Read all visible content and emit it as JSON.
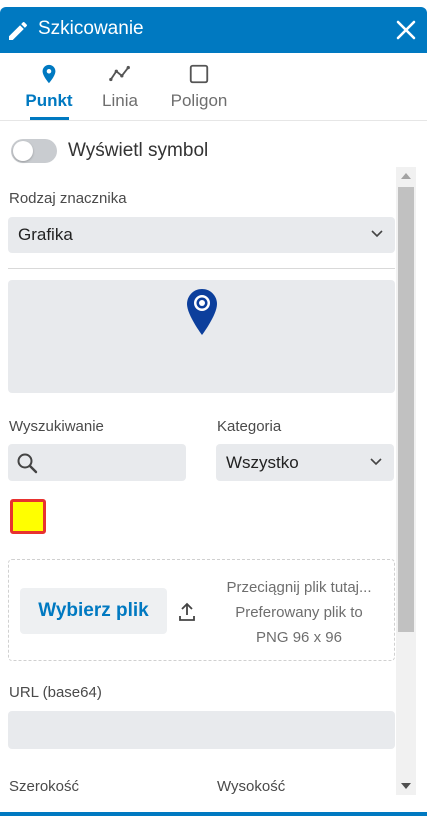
{
  "header": {
    "title": "Szkicowanie",
    "icon": "pencil-icon",
    "close_icon": "close-icon",
    "accent": "#0079c1"
  },
  "tabs": [
    {
      "label": "Punkt",
      "icon": "map-pin-icon",
      "active": true
    },
    {
      "label": "Linia",
      "icon": "polyline-icon",
      "active": false
    },
    {
      "label": "Poligon",
      "icon": "square-icon",
      "active": false
    }
  ],
  "toggle": {
    "label": "Wyświetl symbol",
    "checked": false
  },
  "marker_type": {
    "label": "Rodzaj znacznika",
    "value": "Grafika"
  },
  "search": {
    "label": "Wyszukiwanie",
    "placeholder": ""
  },
  "category": {
    "label": "Kategoria",
    "value": "Wszystko"
  },
  "swatch": {
    "fill": "#ffff00",
    "border": "#e8322f"
  },
  "upload": {
    "button_label": "Wybierz plik",
    "line1": "Przeciągnij plik tutaj...",
    "line2": "Preferowany plik to",
    "line3": "PNG 96 x 96"
  },
  "url": {
    "label": "URL (base64)",
    "value": ""
  },
  "size": {
    "width_label": "Szerokość",
    "height_label": "Wysokość"
  }
}
